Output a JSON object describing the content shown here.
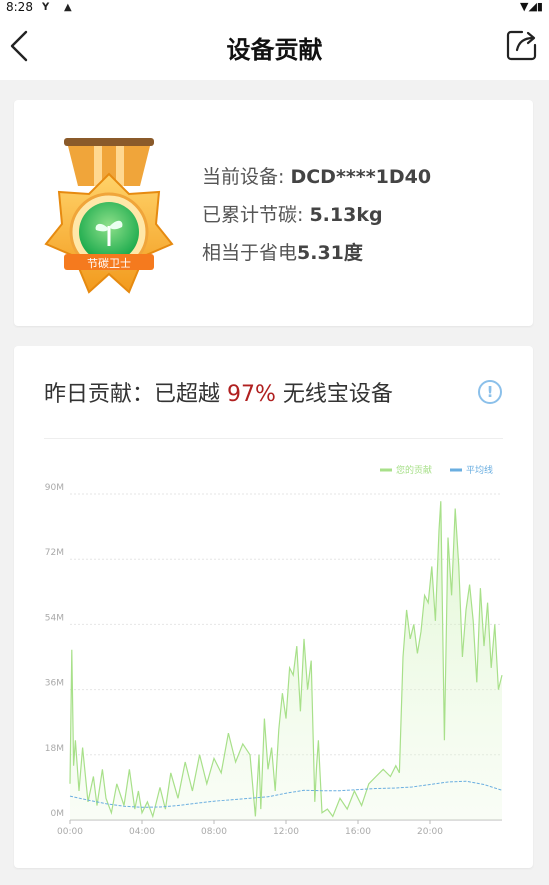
{
  "status_bar": {
    "time": "8:28"
  },
  "app_bar": {
    "title": "设备贡献"
  },
  "device_card": {
    "badge_text": "节碳卫士",
    "device_label": "当前设备: ",
    "device_value": "DCD****1D40",
    "carbon_label": "已累计节碳: ",
    "carbon_value": "5.13kg",
    "power_label": "相当于省电",
    "power_value": "5.31度"
  },
  "contribution_card": {
    "heading_prefix": "昨日贡献：已超越 ",
    "heading_percent": "97%",
    "heading_suffix": " 无线宝设备",
    "info_icon": "!"
  },
  "colors": {
    "your_line": "#a8e08a",
    "avg_line": "#6aaee0",
    "highlight": "#b02020"
  },
  "chart_data": {
    "type": "line",
    "title": "",
    "xlabel": "",
    "ylabel": "",
    "legend_position": "top-right",
    "x_ticks": [
      "00:00",
      "04:00",
      "08:00",
      "12:00",
      "16:00",
      "20:00"
    ],
    "y_ticks": [
      "0M",
      "18M",
      "36M",
      "54M",
      "72M",
      "90M"
    ],
    "ylim": [
      0,
      90
    ],
    "xlim_hours": [
      0,
      24
    ],
    "series": [
      {
        "name": "您的贡献",
        "x": [
          0,
          0.1,
          0.2,
          0.3,
          0.5,
          0.7,
          1.0,
          1.3,
          1.5,
          1.8,
          2.0,
          2.3,
          2.6,
          3.0,
          3.3,
          3.6,
          3.8,
          4.0,
          4.3,
          4.6,
          5.0,
          5.3,
          5.6,
          6.0,
          6.4,
          6.8,
          7.2,
          7.6,
          8.0,
          8.4,
          8.8,
          9.2,
          9.6,
          10.0,
          10.3,
          10.5,
          10.6,
          10.8,
          11.0,
          11.2,
          11.4,
          11.6,
          11.8,
          12.0,
          12.2,
          12.4,
          12.6,
          12.8,
          13.0,
          13.2,
          13.4,
          13.6,
          13.7,
          13.8,
          14.0,
          14.3,
          14.6,
          15.0,
          15.4,
          15.8,
          16.2,
          16.6,
          17.0,
          17.4,
          17.8,
          18.1,
          18.3,
          18.5,
          18.7,
          18.9,
          19.1,
          19.3,
          19.5,
          19.7,
          19.9,
          20.1,
          20.3,
          20.5,
          20.6,
          20.8,
          21.0,
          21.2,
          21.4,
          21.6,
          21.8,
          22.0,
          22.2,
          22.4,
          22.6,
          22.8,
          23.0,
          23.2,
          23.4,
          23.6,
          23.8,
          24.0
        ],
        "y": [
          10,
          47,
          15,
          22,
          8,
          20,
          5,
          12,
          4,
          14,
          6,
          2,
          10,
          4,
          14,
          3,
          8,
          2,
          5,
          1,
          9,
          3,
          13,
          6,
          16,
          8,
          18,
          10,
          17,
          13,
          24,
          16,
          21,
          18,
          1,
          18,
          3,
          28,
          14,
          20,
          8,
          25,
          35,
          28,
          42,
          40,
          48,
          30,
          50,
          36,
          44,
          5,
          15,
          22,
          2,
          3,
          1,
          6,
          3,
          8,
          4,
          10,
          12,
          14,
          12,
          15,
          13,
          45,
          58,
          50,
          54,
          46,
          52,
          62,
          60,
          70,
          55,
          80,
          88,
          22,
          78,
          62,
          86,
          70,
          45,
          58,
          65,
          55,
          38,
          64,
          48,
          60,
          42,
          54,
          36,
          40
        ]
      },
      {
        "name": "平均线",
        "x": [
          0,
          1,
          2,
          3,
          4,
          5,
          6,
          7,
          8,
          9,
          10,
          11,
          12,
          13,
          14,
          15,
          16,
          17,
          18,
          19,
          20,
          21,
          22,
          23,
          24
        ],
        "y": [
          6.6,
          5.5,
          4.5,
          3.8,
          3.5,
          3.6,
          4.0,
          4.6,
          5.2,
          5.6,
          6.0,
          6.4,
          7.4,
          8.2,
          8.1,
          8.1,
          8.4,
          8.7,
          8.8,
          9.1,
          9.8,
          10.5,
          10.7,
          9.8,
          8.2
        ]
      }
    ]
  }
}
